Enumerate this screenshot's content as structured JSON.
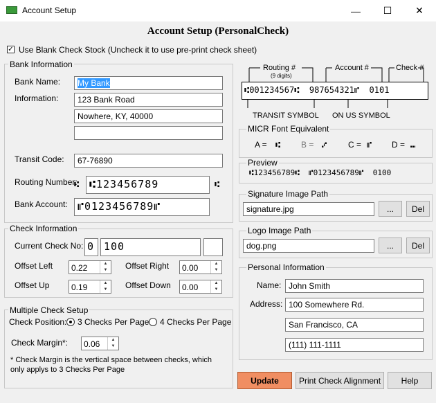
{
  "window": {
    "title": "Account Setup",
    "minimize": "—",
    "maximize": "☐",
    "close": "✕"
  },
  "heading": "Account Setup (PersonalCheck)",
  "blank_check": {
    "checked": "✓",
    "label": "Use Blank Check Stock (Uncheck it to use pre-print check sheet)"
  },
  "bank": {
    "legend": "Bank Information",
    "name_label": "Bank Name:",
    "name_value": "My Bank",
    "info_label": "Information:",
    "info_line1": "123 Bank Road",
    "info_line2": "Nowhere, KY, 40000",
    "info_line3": "",
    "transit_label": "Transit Code:",
    "transit_value": "67-76890",
    "routing_label": "Routing Number:",
    "routing_prefix": "⑆",
    "routing_value": "⑆123456789",
    "routing_suffix": "⑆",
    "account_label": "Bank Account:",
    "account_value": "⑈0123456789⑈"
  },
  "check_info": {
    "legend": "Check Information",
    "current_label": "Current Check No:",
    "current_prefix": "0",
    "current_value": "100",
    "current_suffix": "",
    "offset_left_label": "Offset Left",
    "offset_left": "0.22",
    "offset_right_label": "Offset Right",
    "offset_right": "0.00",
    "offset_up_label": "Offset Up",
    "offset_up": "0.19",
    "offset_down_label": "Offset Down",
    "offset_down": "0.00"
  },
  "multi": {
    "legend": "Multiple Check Setup",
    "position_label": "Check Position:",
    "opt3": "3 Checks Per Page",
    "opt4": "4 Checks Per Page",
    "margin_label": "Check Margin*:",
    "margin_value": "0.06",
    "note1": "* Check Margin is the vertical space between checks, which",
    "note2": "only applys to 3 Checks Per Page"
  },
  "micr_diagram": {
    "routing": "Routing #",
    "routing_sub": "(9 digits)",
    "account": "Account #",
    "check": "Check #",
    "line": "⑆001234567⑆  987654321⑈  0101",
    "transit_symbol": "TRANSIT SYMBOL",
    "onus_symbol": "ON US SYMBOL"
  },
  "micr_font": {
    "legend": "MICR Font Equivalent",
    "a": "A =",
    "a_glyph": "⑆",
    "b": "B =",
    "b_glyph": "⑇",
    "c": "C =",
    "c_glyph": "⑈",
    "d": "D =",
    "d_glyph": "⑉"
  },
  "preview": {
    "legend": "Preview",
    "text": "⑆123456789⑆  ⑈0123456789⑈  0100"
  },
  "signature": {
    "legend": "Signature Image Path",
    "value": "signature.jpg",
    "browse": "...",
    "del": "Del"
  },
  "logo": {
    "legend": "Logo Image Path",
    "value": "dog.png",
    "browse": "...",
    "del": "Del"
  },
  "personal": {
    "legend": "Personal Information",
    "name_label": "Name:",
    "name_value": "John Smith",
    "address_label": "Address:",
    "addr1": "100 Somewhere Rd.",
    "addr2": "San Francisco, CA",
    "addr3": "(111) 111-1111"
  },
  "buttons": {
    "update": "Update",
    "align": "Print Check Alignment",
    "help": "Help"
  },
  "spin_up": "▲",
  "spin_down": "▼"
}
